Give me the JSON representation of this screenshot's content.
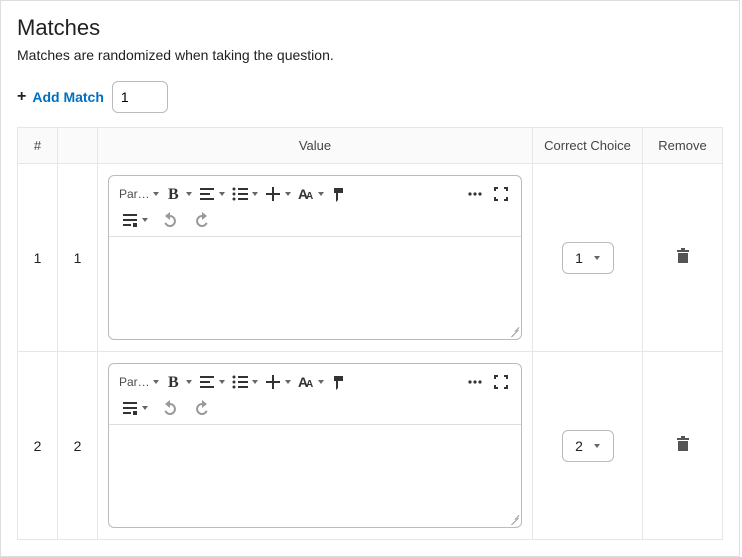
{
  "title": "Matches",
  "subtitle": "Matches are randomized when taking the question.",
  "add_match_label": "Add Match",
  "add_count_value": "1",
  "columns": {
    "hash": "#",
    "value": "Value",
    "choice": "Correct Choice",
    "remove": "Remove"
  },
  "toolbar": {
    "para_label": "Par…"
  },
  "rows": [
    {
      "hash": "1",
      "num": "1",
      "choice": "1"
    },
    {
      "hash": "2",
      "num": "2",
      "choice": "2"
    }
  ]
}
